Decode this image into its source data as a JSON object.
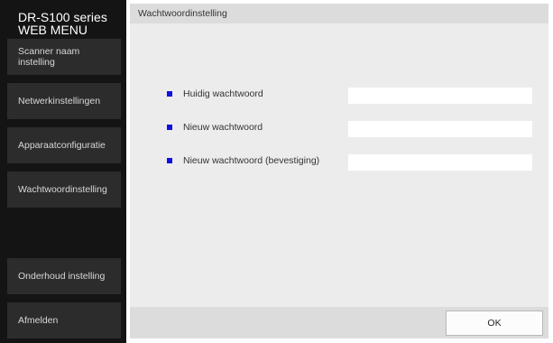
{
  "app": {
    "title_line1": "DR-S100 series",
    "title_line2": "WEB MENU"
  },
  "sidebar": {
    "items": [
      {
        "label_line1": "Scanner naam",
        "label_line2": "instelling"
      },
      {
        "label": "Netwerkinstellingen"
      },
      {
        "label": "Apparaatconfiguratie"
      },
      {
        "label": "Wachtwoordinstelling"
      },
      {
        "label": "Onderhoud instelling"
      },
      {
        "label": "Afmelden"
      }
    ]
  },
  "panel": {
    "title": "Wachtwoordinstelling"
  },
  "form": {
    "fields": [
      {
        "label": "Huidig wachtwoord",
        "value": "",
        "placeholder": ""
      },
      {
        "label": "Nieuw wachtwoord",
        "value": "",
        "placeholder": ""
      },
      {
        "label": "Nieuw wachtwoord (bevestiging)",
        "value": "",
        "placeholder": ""
      }
    ]
  },
  "footer": {
    "ok_label": "OK"
  },
  "colors": {
    "sidebar_bg": "#141414",
    "sidebar_item_bg": "#2c2c2c",
    "panel_bg": "#ececec",
    "header_bg": "#dcdcdc",
    "bullet": "#1010e0"
  }
}
